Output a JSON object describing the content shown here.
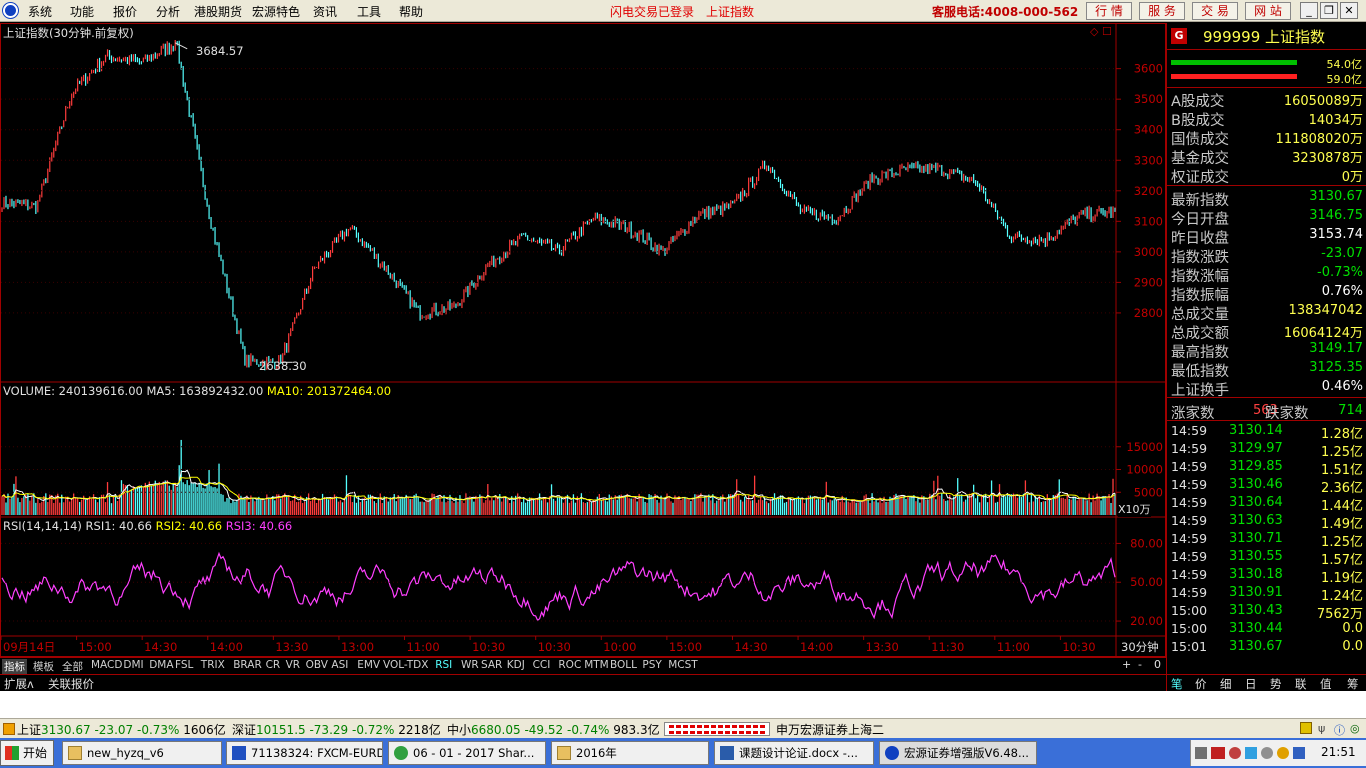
{
  "menu": {
    "items": [
      "系统",
      "功能",
      "报价",
      "分析",
      "港股期货",
      "宏源特色",
      "资讯",
      "工具",
      "帮助"
    ],
    "status": "闪电交易已登录",
    "index_name": "上证指数",
    "hotline": "客服电话:4008-000-562",
    "buttons": [
      "行 情",
      "服 务",
      "交 易",
      "网 站"
    ]
  },
  "chart": {
    "title": "上证指数(30分钟.前复权)",
    "high_label": "3684.57",
    "low_label": "2638.30",
    "y_ticks": [
      "3600",
      "3500",
      "3400",
      "3300",
      "3200",
      "3100",
      "3000",
      "2900",
      "2800"
    ],
    "volume_header": {
      "label": "VOLUME: 240139616.00",
      "ma5": "MA5: 163892432.00",
      "ma10": "MA10: 201372464.00"
    },
    "volume_ticks": [
      "15000",
      "10000",
      "5000"
    ],
    "volume_unit": "X10万",
    "rsi_header": {
      "label": "RSI(14,14,14)",
      "rsi1": "RSI1: 40.66",
      "rsi2": "RSI2: 40.66",
      "rsi3": "RSI3: 40.66"
    },
    "rsi_ticks": [
      "80.00",
      "50.00",
      "20.00"
    ],
    "x_ticks": [
      "09月14日",
      "15:00",
      "14:30",
      "14:00",
      "13:30",
      "13:00",
      "11:00",
      "10:30",
      "10:30",
      "10:00",
      "15:00",
      "14:30",
      "14:00",
      "13:30",
      "11:30",
      "11:00",
      "10:30"
    ],
    "period": "30分钟",
    "colors": {
      "up": "#ff3c3c",
      "down": "#54ffff",
      "price_line": "#ffffff",
      "ma5": "#ffffff",
      "ma10": "#ffff00",
      "rsi": "#ff40ff",
      "axis": "#a00000"
    }
  },
  "chart_data": {
    "type": "line",
    "title": "上证指数(30分钟.前复权)",
    "xlabel": "",
    "ylabel": "",
    "ylim": [
      2600,
      3720
    ],
    "x": [
      "09月14日",
      "15:00",
      "14:30",
      "14:00",
      "13:30",
      "13:00",
      "11:00",
      "10:30",
      "10:30",
      "10:00",
      "15:00",
      "14:30",
      "14:00",
      "13:30",
      "11:30",
      "11:00",
      "10:30"
    ],
    "series": [
      {
        "values": [
          3160,
          3150,
          3520,
          3640,
          3620,
          3684.57,
          3100,
          2640,
          2638.3,
          2950,
          3080,
          2950,
          2800,
          2820,
          2960,
          3050,
          3000,
          3110,
          3080,
          3000,
          3120,
          3150,
          3290,
          3130,
          3110,
          3240,
          3270,
          3270,
          3230,
          3050,
          3040,
          3120,
          3130
        ]
      }
    ],
    "annotations": {
      "high": 3684.57,
      "low": 2638.3
    }
  },
  "tabs": [
    "指标",
    "模板",
    "全部",
    "MACD",
    "DMI",
    "DMA",
    "FSL",
    "TRIX",
    "BRAR",
    "CR",
    "VR",
    "OBV",
    "ASI",
    "EMV",
    "VOL-TDX",
    "RSI",
    "WR",
    "SAR",
    "KDJ",
    "CCI",
    "ROC",
    "MTM",
    "BOLL",
    "PSY",
    "MCST"
  ],
  "tabs_right": [
    "+",
    "-",
    "0"
  ],
  "ext": [
    "扩展ʌ",
    "关联报价"
  ],
  "right": {
    "badge": "G",
    "code": "999999",
    "name": "上证指数",
    "bar_top": "54.0亿",
    "bar_bottom": "59.0亿",
    "turnover": [
      {
        "label": "A股成交",
        "value": "16050089万"
      },
      {
        "label": "B股成交",
        "value": "14034万"
      },
      {
        "label": "国债成交",
        "value": "111808020万"
      },
      {
        "label": "基金成交",
        "value": "3230878万"
      },
      {
        "label": "权证成交",
        "value": "0万"
      }
    ],
    "stats": [
      {
        "label": "最新指数",
        "value": "3130.67",
        "color": "#00e000"
      },
      {
        "label": "今日开盘",
        "value": "3146.75",
        "color": "#00e000"
      },
      {
        "label": "昨日收盘",
        "value": "3153.74",
        "color": "#ffffff"
      },
      {
        "label": "指数涨跌",
        "value": "-23.07",
        "color": "#00e000"
      },
      {
        "label": "指数涨幅",
        "value": "-0.73%",
        "color": "#00e000"
      },
      {
        "label": "指数振幅",
        "value": "0.76%",
        "color": "#ffffff"
      },
      {
        "label": "总成交量",
        "value": "138347042",
        "color": "#ffff50"
      },
      {
        "label": "总成交额",
        "value": "16064124万",
        "color": "#ffff50"
      },
      {
        "label": "最高指数",
        "value": "3149.17",
        "color": "#00e000"
      },
      {
        "label": "最低指数",
        "value": "3125.35",
        "color": "#00e000"
      },
      {
        "label": "上证换手",
        "value": "0.46%",
        "color": "#ffffff"
      }
    ],
    "up_label": "涨家数",
    "up_count": "563",
    "down_label": "跌家数",
    "down_count": "714",
    "ticks": [
      {
        "time": "14:59",
        "price": "3130.14",
        "vol": "1.28亿"
      },
      {
        "time": "14:59",
        "price": "3129.97",
        "vol": "1.25亿"
      },
      {
        "time": "14:59",
        "price": "3129.85",
        "vol": "1.51亿"
      },
      {
        "time": "14:59",
        "price": "3130.46",
        "vol": "2.36亿"
      },
      {
        "time": "14:59",
        "price": "3130.64",
        "vol": "1.44亿"
      },
      {
        "time": "14:59",
        "price": "3130.63",
        "vol": "1.49亿"
      },
      {
        "time": "14:59",
        "price": "3130.71",
        "vol": "1.25亿"
      },
      {
        "time": "14:59",
        "price": "3130.55",
        "vol": "1.57亿"
      },
      {
        "time": "14:59",
        "price": "3130.18",
        "vol": "1.19亿"
      },
      {
        "time": "14:59",
        "price": "3130.91",
        "vol": "1.24亿"
      },
      {
        "time": "15:00",
        "price": "3130.43",
        "vol": "7562万"
      },
      {
        "time": "15:00",
        "price": "3130.44",
        "vol": "0.0"
      },
      {
        "time": "15:01",
        "price": "3130.67",
        "vol": "0.0"
      }
    ],
    "bottom_tabs": [
      "笔",
      "价",
      "细",
      "日",
      "势",
      "联",
      "值",
      "筹"
    ]
  },
  "status": {
    "sh_label": "上证",
    "sh_price": "3130.67",
    "sh_chg": "-23.07",
    "sh_pct": "-0.73%",
    "sh_amt": "1606亿",
    "sz_label": "深证",
    "sz_price": "10151.5",
    "sz_chg": "-73.29",
    "sz_pct": "-0.72%",
    "sz_amt": "2218亿",
    "zx_label": "中小",
    "zx_price": "6680.05",
    "zx_chg": "-49.52",
    "zx_pct": "-0.74%",
    "zx_amt": "983.3亿",
    "server": "申万宏源证券上海二"
  },
  "taskbar": {
    "start": "开始",
    "tasks": [
      "new_hyzq_v6",
      "71138324: FXCM-EURD...",
      "06 - 01 - 2017 Shar...",
      "2016年",
      "课题设计论证.docx -...",
      "宏源证券增强版V6.48..."
    ],
    "time": "21:51"
  }
}
